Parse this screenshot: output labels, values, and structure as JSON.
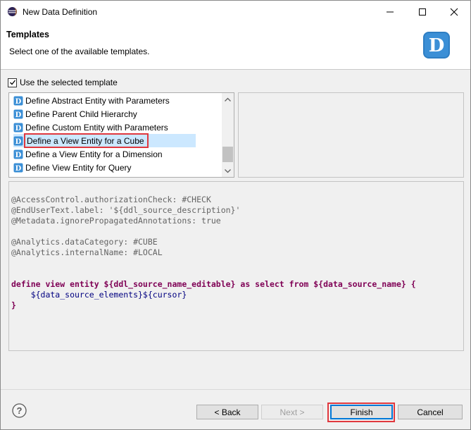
{
  "window": {
    "title": "New Data Definition"
  },
  "header": {
    "title": "Templates",
    "description": "Select one of the available templates.",
    "logo_letter": "D"
  },
  "checkbox": {
    "label": "Use the selected template",
    "checked": true
  },
  "templates": {
    "items": [
      {
        "label": "Define Abstract Entity with Parameters"
      },
      {
        "label": "Define Parent Child Hierarchy"
      },
      {
        "label": "Define Custom Entity with Parameters"
      },
      {
        "label": "Define a View Entity for a Cube",
        "selected": true
      },
      {
        "label": "Define a View Entity for a Dimension"
      },
      {
        "label": "Define View Entity for Query"
      }
    ]
  },
  "code": {
    "lines": [
      "@AccessControl.authorizationCheck: #CHECK",
      "@EndUserText.label: '${ddl_source_description}'",
      "@Metadata.ignorePropagatedAnnotations: true",
      "",
      "@Analytics.dataCategory: #CUBE",
      "@Analytics.internalName: #LOCAL",
      "",
      "",
      "define view entity ${ddl_source_name_editable} as select from ${data_source_name} {",
      "    ${data_source_elements}${cursor}",
      "}"
    ]
  },
  "buttons": {
    "back": "< Back",
    "next": "Next >",
    "finish": "Finish",
    "cancel": "Cancel",
    "help": "?"
  },
  "colors": {
    "selection": "#cce8ff",
    "highlight": "#e0383e",
    "annotation": "#646464",
    "keyword": "#7f0055",
    "accent": "#0078d7"
  }
}
